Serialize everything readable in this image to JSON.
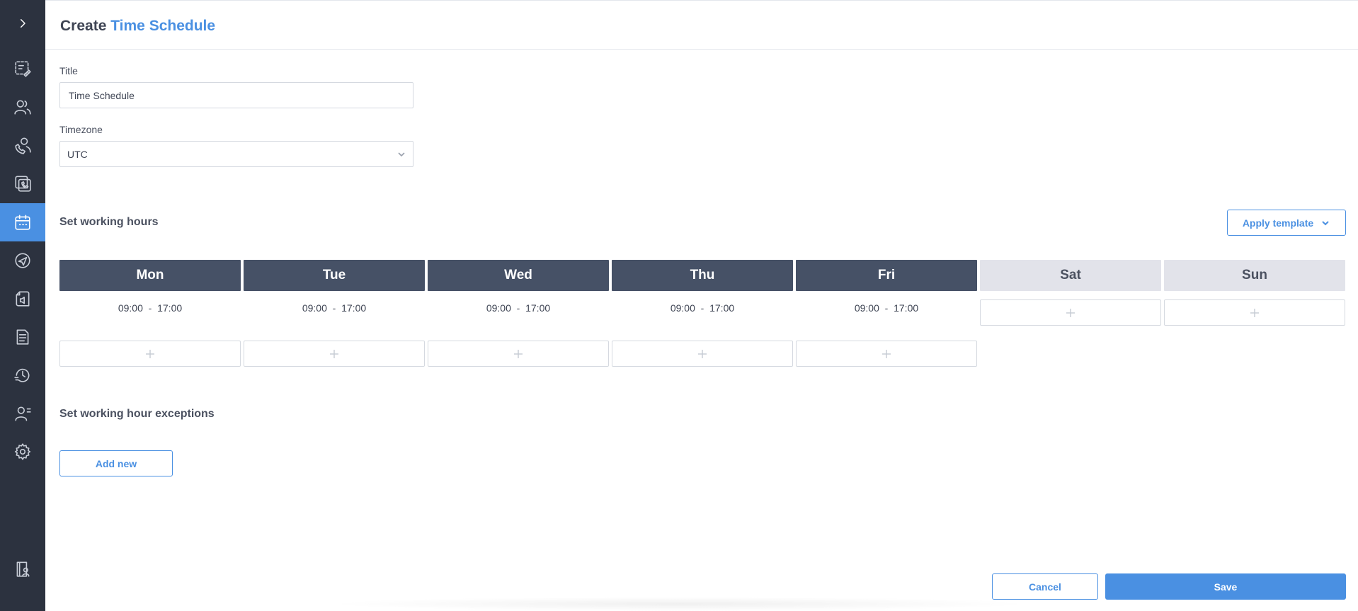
{
  "sidebar": {
    "toggle_icon": "chevron-right-icon",
    "items": [
      {
        "name": "schedule-edit",
        "icon": "note-edit-icon"
      },
      {
        "name": "users",
        "icon": "users-icon"
      },
      {
        "name": "call-agent",
        "icon": "agent-phone-icon"
      },
      {
        "name": "phone-numbers",
        "icon": "phone-copy-icon"
      },
      {
        "name": "time-schedules",
        "icon": "calendar-icon",
        "active": true
      },
      {
        "name": "campaigns",
        "icon": "rocket-icon"
      },
      {
        "name": "audio-files",
        "icon": "file-audio-icon"
      },
      {
        "name": "reports",
        "icon": "document-icon"
      },
      {
        "name": "history",
        "icon": "history-icon"
      },
      {
        "name": "contacts",
        "icon": "contacts-icon"
      },
      {
        "name": "settings",
        "icon": "gear-icon"
      }
    ],
    "bottom_icon": "account-book-icon"
  },
  "header": {
    "title_prefix": "Create",
    "title_accent": "Time Schedule"
  },
  "form": {
    "title_label": "Title",
    "title_value": "Time Schedule",
    "timezone_label": "Timezone",
    "timezone_value": "UTC"
  },
  "working_hours": {
    "section_title": "Set working hours",
    "apply_template_label": "Apply template",
    "days": [
      {
        "label": "Mon",
        "active": true,
        "slots": [
          {
            "start": "09:00",
            "end": "17:00"
          }
        ]
      },
      {
        "label": "Tue",
        "active": true,
        "slots": [
          {
            "start": "09:00",
            "end": "17:00"
          }
        ]
      },
      {
        "label": "Wed",
        "active": true,
        "slots": [
          {
            "start": "09:00",
            "end": "17:00"
          }
        ]
      },
      {
        "label": "Thu",
        "active": true,
        "slots": [
          {
            "start": "09:00",
            "end": "17:00"
          }
        ]
      },
      {
        "label": "Fri",
        "active": true,
        "slots": [
          {
            "start": "09:00",
            "end": "17:00"
          }
        ]
      },
      {
        "label": "Sat",
        "active": false,
        "slots": []
      },
      {
        "label": "Sun",
        "active": false,
        "slots": []
      }
    ],
    "time_separator": "-"
  },
  "exceptions": {
    "section_title": "Set working hour exceptions",
    "add_new_label": "Add new"
  },
  "footer": {
    "cancel_label": "Cancel",
    "save_label": "Save"
  },
  "colors": {
    "accent": "#4a90e2",
    "sidebar": "#2c323f",
    "day_active": "#465166",
    "day_inactive": "#e2e3ea"
  }
}
